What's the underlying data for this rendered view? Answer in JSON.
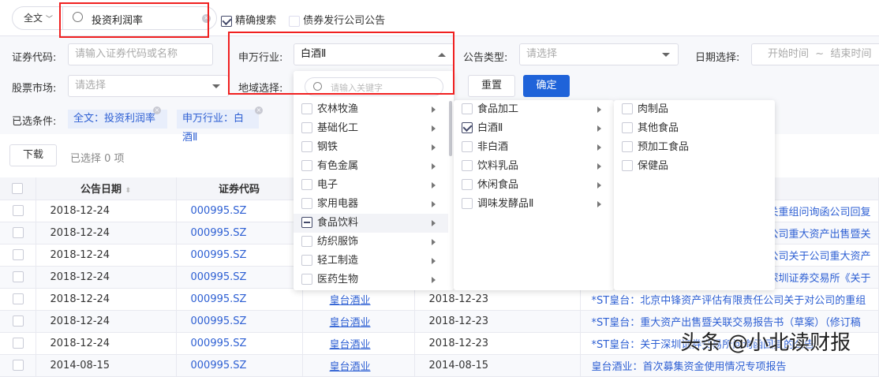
{
  "search": {
    "scope": "全文",
    "query": "投资利润率",
    "exact_label": "精确搜索",
    "exact_checked": true,
    "bond_label": "债券发行公司公告",
    "bond_checked": false
  },
  "filters": {
    "code_label": "证券代码:",
    "code_placeholder": "请输入证券代码或名称",
    "industry_label": "申万行业:",
    "industry_value": "白酒Ⅱ",
    "type_label": "公告类型:",
    "type_placeholder": "请选择",
    "date_label": "日期选择:",
    "date_start": "开始时间",
    "date_sep": "~",
    "date_end": "结束时间",
    "market_label": "股票市场:",
    "market_placeholder": "请选择",
    "region_label": "地域选择:",
    "reset": "重置",
    "confirm": "确定",
    "selected_label": "已选条件:",
    "tags": [
      "全文：投资利润率",
      "申万行业：白酒Ⅱ"
    ]
  },
  "toolbar": {
    "download": "下载",
    "selected_count": "已选择 0 项"
  },
  "dropdown": {
    "search_placeholder": "请输入关键字",
    "level1": [
      {
        "label": "农林牧渔",
        "state": "off"
      },
      {
        "label": "基础化工",
        "state": "off"
      },
      {
        "label": "钢铁",
        "state": "off"
      },
      {
        "label": "有色金属",
        "state": "off"
      },
      {
        "label": "电子",
        "state": "off"
      },
      {
        "label": "家用电器",
        "state": "off"
      },
      {
        "label": "食品饮料",
        "state": "half"
      },
      {
        "label": "纺织服饰",
        "state": "off"
      },
      {
        "label": "轻工制造",
        "state": "off"
      },
      {
        "label": "医药生物",
        "state": "off"
      }
    ],
    "level2": [
      {
        "label": "食品加工",
        "state": "off"
      },
      {
        "label": "白酒Ⅱ",
        "state": "on"
      },
      {
        "label": "非白酒",
        "state": "off"
      },
      {
        "label": "饮料乳品",
        "state": "off"
      },
      {
        "label": "休闲食品",
        "state": "off"
      },
      {
        "label": "调味发酵品Ⅱ",
        "state": "off"
      }
    ],
    "level3": [
      {
        "label": "肉制品"
      },
      {
        "label": "其他食品"
      },
      {
        "label": "预加工食品"
      },
      {
        "label": "保健品"
      }
    ]
  },
  "table": {
    "headers": [
      "公告日期",
      "证券代码"
    ],
    "rows": [
      {
        "date": "2018-12-24",
        "code": "000995.SZ",
        "name": "",
        "pub": "",
        "title": "关重组问询函公司回复"
      },
      {
        "date": "2018-12-24",
        "code": "000995.SZ",
        "name": "",
        "pub": "",
        "title": "公司重大资产出售暨关"
      },
      {
        "date": "2018-12-24",
        "code": "000995.SZ",
        "name": "",
        "pub": "",
        "title": "公司关于公司重大资产"
      },
      {
        "date": "2018-12-24",
        "code": "000995.SZ",
        "name": "",
        "pub": "",
        "title": "深圳证券交易所《关于"
      },
      {
        "date": "2018-12-24",
        "code": "000995.SZ",
        "name": "皇台酒业",
        "pub": "2018-12-23",
        "title": "*ST皇台：北京中锋资产评估有限责任公司关于对公司的重组"
      },
      {
        "date": "2018-12-24",
        "code": "000995.SZ",
        "name": "皇台酒业",
        "pub": "2018-12-23",
        "title": "*ST皇台：重大资产出售暨关联交易报告书（草案）（修订稿"
      },
      {
        "date": "2018-12-24",
        "code": "000995.SZ",
        "name": "皇台酒业",
        "pub": "2018-12-23",
        "title": "*ST皇台：关于深圳证券交易所问询函回复的公告"
      },
      {
        "date": "2014-08-15",
        "code": "000995.SZ",
        "name": "皇台酒业",
        "pub": "2014-08-15",
        "title": "皇台酒业：首次募集资金使用情况专项报告"
      }
    ]
  },
  "watermark": "头条 @小北读财报"
}
